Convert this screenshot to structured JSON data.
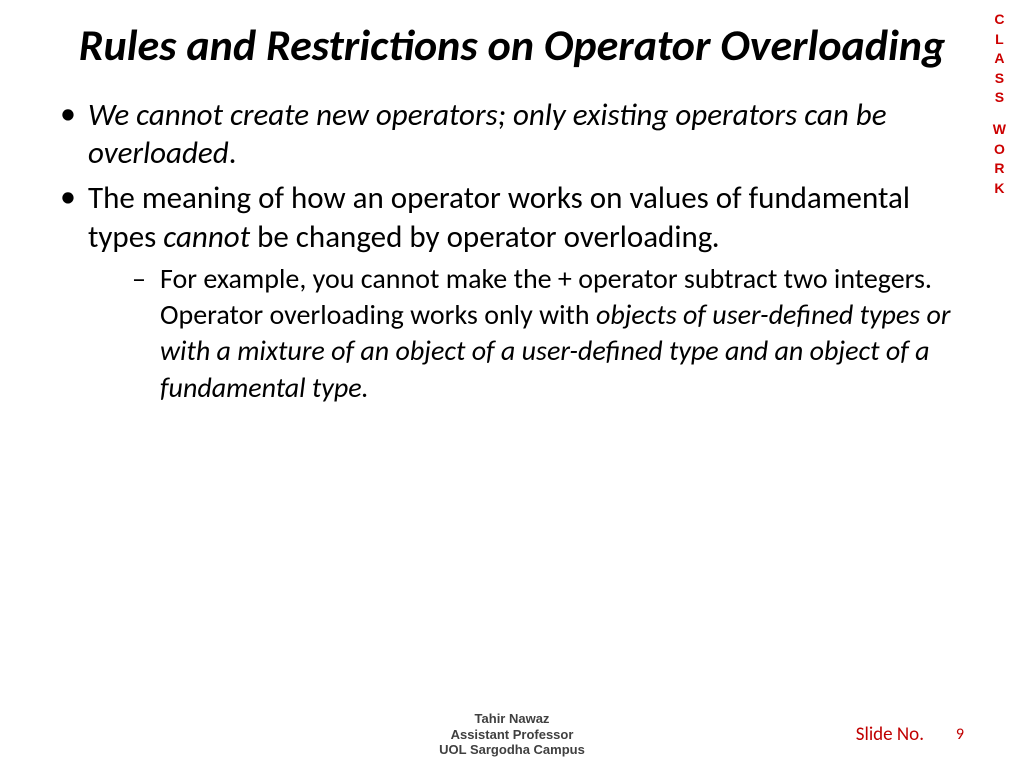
{
  "title": "Rules and Restrictions on Operator Overloading",
  "bullets": {
    "b1_italic": "We cannot create new operators; only existing operators can be overloaded",
    "b1_end": ".",
    "b2_a": "The meaning of how an operator works on values of fundamental types ",
    "b2_cannot": "cannot",
    "b2_b": " be changed by operator overloading",
    "b2_end": ".",
    "sub1_a": "For example, you cannot make the + operator subtract two integers. Operator overloading works only with ",
    "sub1_italic": "objects of user-defined types or with a mixture of an object of a user-defined type and an object of a fundamental type."
  },
  "sideLabel": {
    "c1": "C",
    "c2": "L",
    "c3": "A",
    "c4": "S",
    "c5": "S",
    "c6": "W",
    "c7": "O",
    "c8": "R",
    "c9": "K"
  },
  "footer": {
    "line1": "Tahir Nawaz",
    "line2": "Assistant Professor",
    "line3": "UOL Sargodha Campus"
  },
  "slideNo": {
    "label": "Slide No.",
    "value": "9"
  }
}
